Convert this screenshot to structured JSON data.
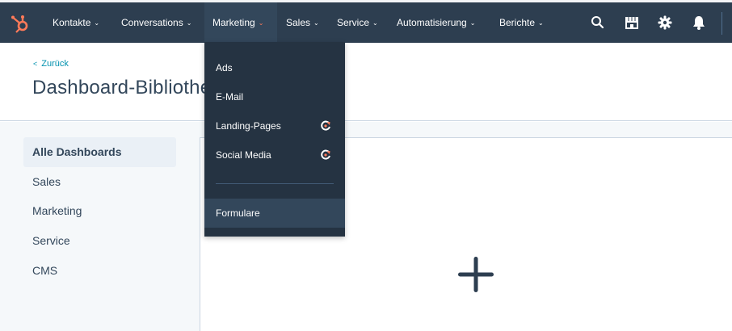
{
  "nav": {
    "items": [
      {
        "label": "Kontakte",
        "chevron": "⌄"
      },
      {
        "label": "Conversations",
        "chevron": "⌄"
      },
      {
        "label": "Marketing",
        "chevron": "⌄"
      },
      {
        "label": "Sales",
        "chevron": "⌄"
      },
      {
        "label": "Service",
        "chevron": "⌄"
      },
      {
        "label": "Automatisierung",
        "chevron": "⌄"
      },
      {
        "label": "Berichte",
        "chevron": "⌄"
      }
    ],
    "active_index": 2,
    "icons": [
      "search-icon",
      "marketplace-icon",
      "settings-icon",
      "notifications-icon"
    ],
    "logo": "hubspot-logo"
  },
  "header": {
    "back_arrow": "<",
    "back_label": "Zurück",
    "title": "Dashboard-Bibliothek"
  },
  "sidebar": {
    "items": [
      {
        "label": "Alle Dashboards",
        "active": true
      },
      {
        "label": "Sales",
        "active": false
      },
      {
        "label": "Marketing",
        "active": false
      },
      {
        "label": "Service",
        "active": false
      },
      {
        "label": "CMS",
        "active": false
      }
    ]
  },
  "dropdown": {
    "items": [
      {
        "label": "Ads",
        "badge": false
      },
      {
        "label": "E-Mail",
        "badge": false
      },
      {
        "label": "Landing-Pages",
        "badge": true
      },
      {
        "label": "Social Media",
        "badge": true
      },
      {
        "label": "Formulare",
        "badge": false,
        "hover": true
      }
    ]
  },
  "panel": {
    "icon": "plus-icon"
  },
  "colors": {
    "nav_bg": "#2d3e50",
    "dropdown_bg": "#253342",
    "accent": "#ff7a59",
    "link": "#0091ae",
    "text": "#33475b"
  }
}
